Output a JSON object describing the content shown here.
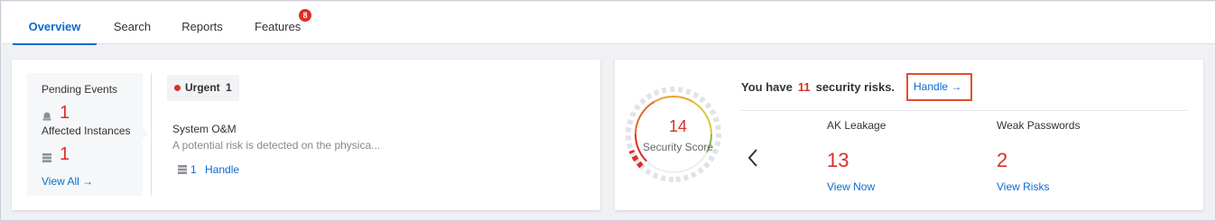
{
  "tabs": [
    {
      "label": "Overview",
      "active": true
    },
    {
      "label": "Search"
    },
    {
      "label": "Reports"
    },
    {
      "label": "Features",
      "badge": "8"
    }
  ],
  "events": {
    "pending_label": "Pending Events",
    "pending_count": "1",
    "affected_label": "Affected Instances",
    "affected_count": "1",
    "view_all": "View All →",
    "urgent_label": "Urgent",
    "urgent_count": "1",
    "item_title": "System O&M",
    "item_desc": "A potential risk is detected on the physica...",
    "item_count": "1",
    "item_handle": "Handle"
  },
  "security": {
    "score": "14",
    "score_label": "Security Score",
    "title_prefix": "You have",
    "risk_count": "11",
    "title_suffix": "security risks.",
    "handle": "Handle →",
    "metrics": [
      {
        "title": "AK Leakage",
        "value": "13",
        "link": "View Now"
      },
      {
        "title": "Weak Passwords",
        "value": "2",
        "link": "View Risks"
      }
    ]
  },
  "colors": {
    "accent": "#0a6bd0",
    "danger": "#d93026",
    "highlight_border": "#e0502d"
  },
  "icons": [
    "pending-events-icon",
    "server-icon",
    "arrow-right-icon",
    "chevron-left-icon"
  ]
}
